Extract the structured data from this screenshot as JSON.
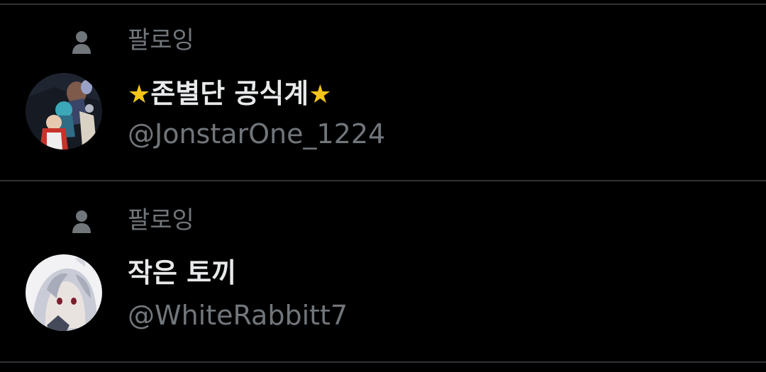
{
  "colors": {
    "background": "#000000",
    "divider": "#2f3336",
    "primary_text": "#e7e9ea",
    "secondary_text": "#71767b",
    "star": "#f5c518"
  },
  "follows": [
    {
      "context_icon": "person-icon",
      "context_label": "팔로잉",
      "star_left": "★",
      "display_name": "존별단 공식계",
      "star_right": "★",
      "handle": "@JonstarOne_1224"
    },
    {
      "context_icon": "person-icon",
      "context_label": "팔로잉",
      "display_name": "작은 토끼",
      "handle": "@WhiteRabbitt7"
    }
  ]
}
